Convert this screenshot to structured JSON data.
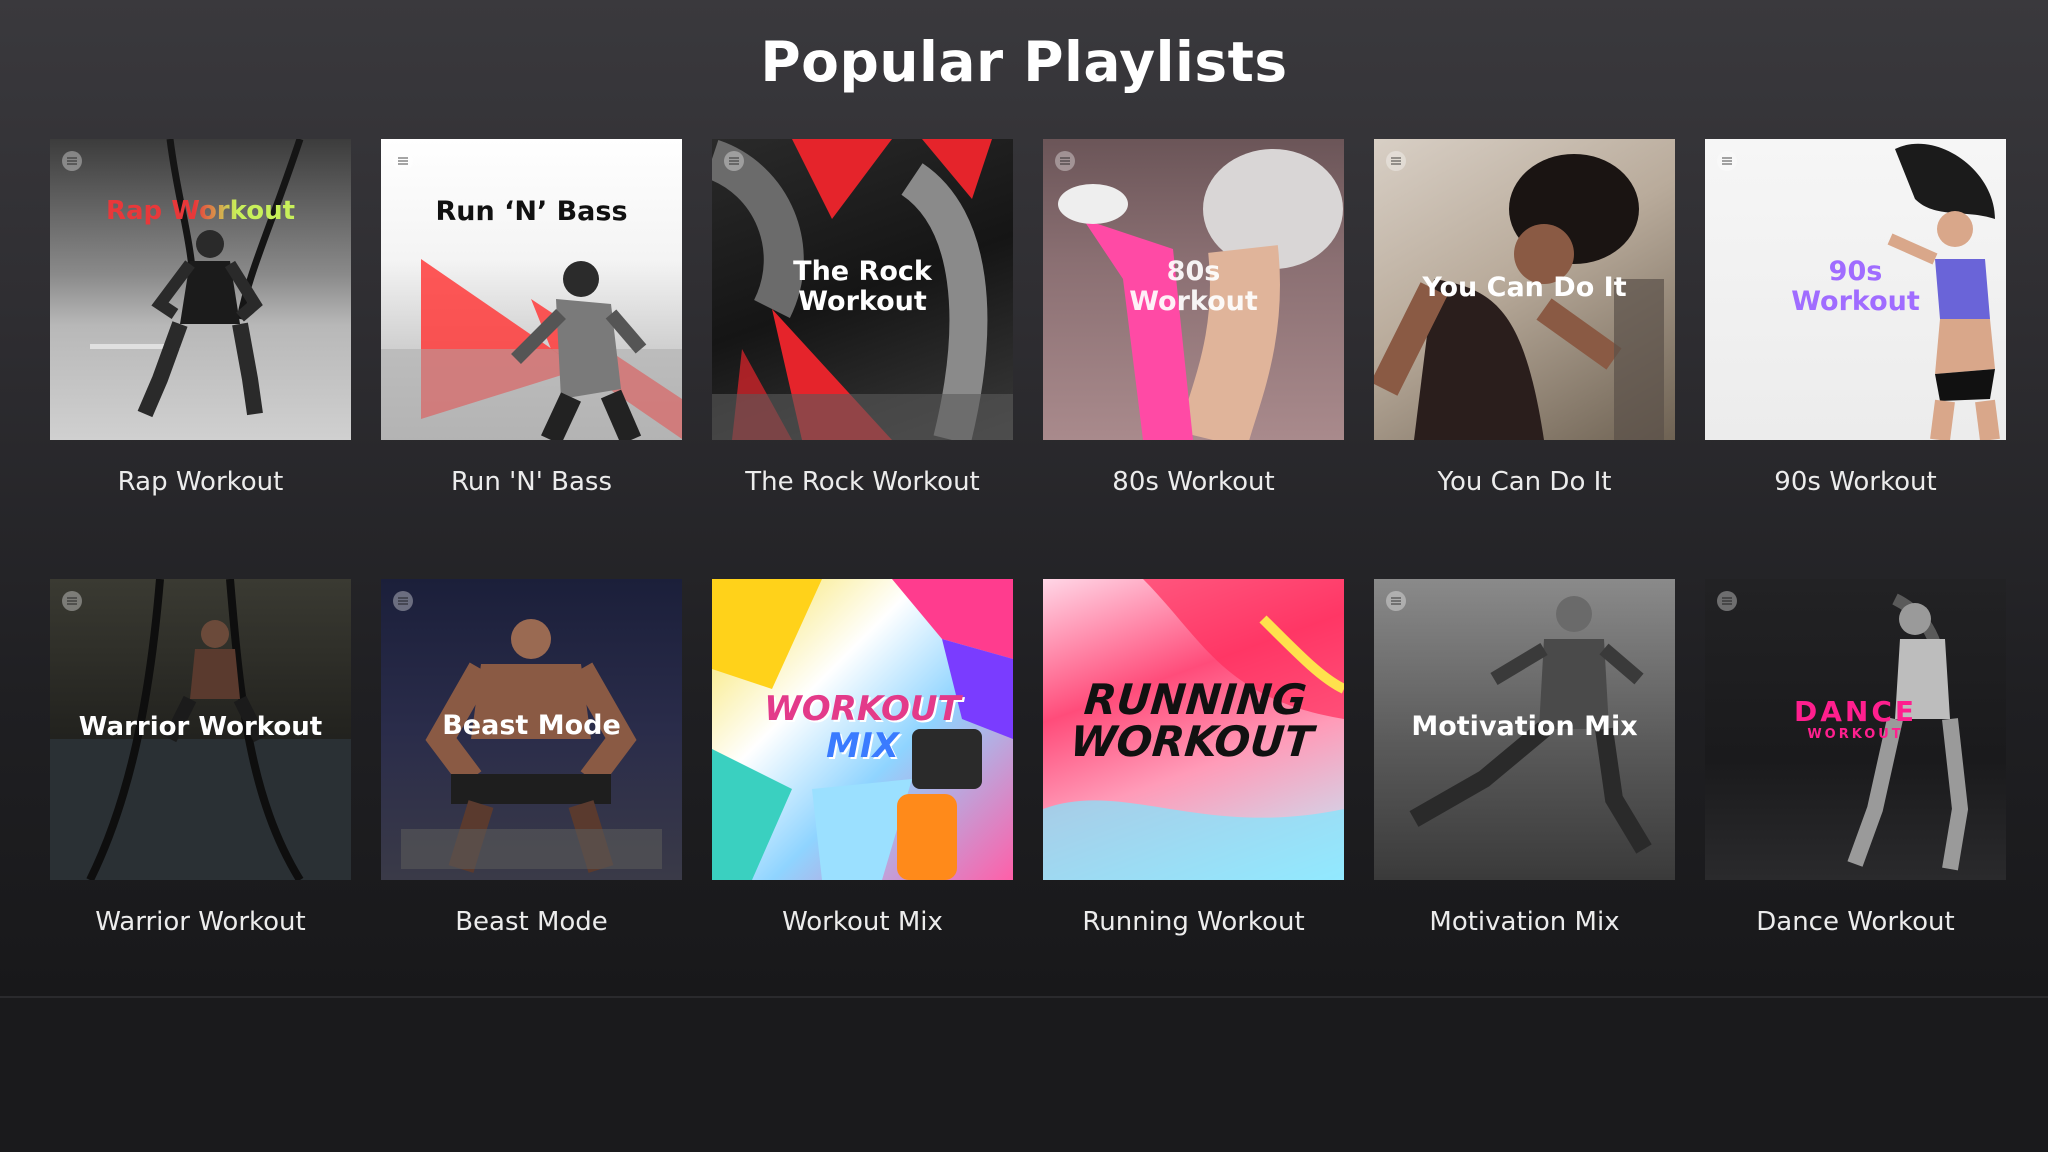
{
  "header": {
    "title": "Popular Playlists"
  },
  "playlists": [
    {
      "label": "Rap Workout",
      "cover_text": "Rap Workout"
    },
    {
      "label": "Run 'N' Bass",
      "cover_text": "Run ‘N’ Bass"
    },
    {
      "label": "The Rock Workout",
      "cover_text_line1": "The Rock",
      "cover_text_line2": "Workout"
    },
    {
      "label": "80s Workout",
      "cover_text_line1": "80s",
      "cover_text_line2": "Workout"
    },
    {
      "label": "You Can Do It",
      "cover_text": "You Can Do It"
    },
    {
      "label": "90s Workout",
      "cover_text_line1": "90s",
      "cover_text_line2": "Workout"
    },
    {
      "label": "Warrior Workout",
      "cover_text": "Warrior Workout"
    },
    {
      "label": "Beast Mode",
      "cover_text": "Beast Mode"
    },
    {
      "label": "Workout Mix",
      "cover_text_line1": "WORKOUT",
      "cover_text_line2": "MIX"
    },
    {
      "label": "Running Workout",
      "cover_text_line1": "RUNNING",
      "cover_text_line2": "WORKOUT"
    },
    {
      "label": "Motivation Mix",
      "cover_text": "Motivation Mix"
    },
    {
      "label": "Dance Workout",
      "cover_text_line1": "DANCE",
      "cover_text_line2": "WORKOUT"
    }
  ],
  "colors": {
    "rap_accent": "#e8383a",
    "rap_accent2": "#c8f05a",
    "run_bass_red": "#ff3b3b",
    "rock_red": "#e5242b",
    "pink_80s": "#ff4aa5",
    "purple_90s": "#a06cff",
    "dance_pink": "#ff1f8e"
  }
}
